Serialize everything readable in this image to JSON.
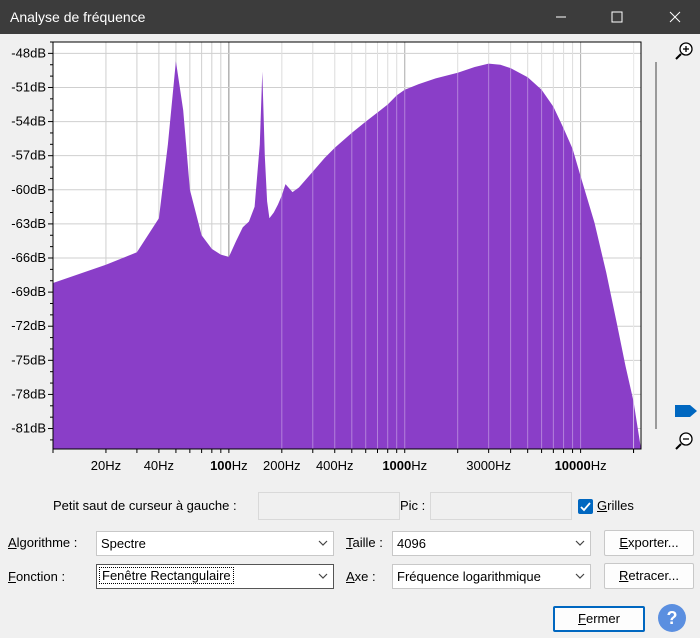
{
  "window": {
    "title": "Analyse de fréquence"
  },
  "chart_data": {
    "type": "area",
    "color": "#8a3ec8",
    "x_scale": "log",
    "xlim": [
      10,
      22050
    ],
    "ylim": [
      -82.8,
      -47
    ],
    "y_ticks": [
      "-48dB",
      "-51dB",
      "-54dB",
      "-57dB",
      "-60dB",
      "-63dB",
      "-66dB",
      "-69dB",
      "-72dB",
      "-75dB",
      "-78dB",
      "-81dB"
    ],
    "y_tick_values": [
      -48,
      -51,
      -54,
      -57,
      -60,
      -63,
      -66,
      -69,
      -72,
      -75,
      -78,
      -81
    ],
    "x_ticks": [
      {
        "label": "20Hz",
        "value": 20,
        "bold": false
      },
      {
        "label": "40Hz",
        "value": 40,
        "bold": false
      },
      {
        "label": "100",
        "value": 100,
        "bold": true,
        "suffix": "Hz"
      },
      {
        "label": "200Hz",
        "value": 200,
        "bold": false
      },
      {
        "label": "400Hz",
        "value": 400,
        "bold": false
      },
      {
        "label": "1000",
        "value": 1000,
        "bold": true,
        "suffix": "Hz"
      },
      {
        "label": "3000Hz",
        "value": 3000,
        "bold": false
      },
      {
        "label": "10000",
        "value": 10000,
        "bold": true,
        "suffix": "Hz"
      }
    ],
    "x": [
      10,
      20,
      30,
      40,
      45,
      50,
      55,
      60,
      70,
      80,
      90,
      100,
      110,
      120,
      130,
      140,
      150,
      155,
      160,
      165,
      170,
      180,
      190,
      200,
      210,
      230,
      250,
      300,
      350,
      400,
      500,
      600,
      700,
      800,
      900,
      1000,
      1200,
      1500,
      2000,
      2500,
      3000,
      3500,
      4000,
      5000,
      6000,
      7000,
      8000,
      9000,
      10000,
      12000,
      14000,
      16000,
      18000,
      20000,
      22050
    ],
    "y": [
      -68.2,
      -66.6,
      -65.5,
      -62.5,
      -56,
      -48.7,
      -53,
      -60,
      -64,
      -65.2,
      -65.7,
      -65.9,
      -64.5,
      -63.3,
      -62.8,
      -61.5,
      -56,
      -49.6,
      -57,
      -61,
      -62.5,
      -62,
      -61.3,
      -60.5,
      -59.5,
      -60.2,
      -59.8,
      -58.4,
      -57.2,
      -56.3,
      -55,
      -54,
      -53.2,
      -52.5,
      -51.7,
      -51.2,
      -50.7,
      -50.2,
      -49.7,
      -49.2,
      -48.9,
      -49,
      -49.3,
      -50.1,
      -51.2,
      -52.7,
      -54.6,
      -56.4,
      -58.8,
      -62.9,
      -67.3,
      -71.6,
      -75.5,
      -78.6,
      -82.8
    ]
  },
  "controls": {
    "cursor_label": "Petit saut de curseur à gauche :",
    "cursor_value": "",
    "pic_label": "Pic :",
    "pic_value": "",
    "grilles_label": "Grilles",
    "grilles_checked": true,
    "algo_label": "Algorithme :",
    "algo_value": "Spectre",
    "taille_label": "Taille :",
    "taille_value": "4096",
    "exporter_label": "Exporter...",
    "fonction_label": "Fonction :",
    "fonction_value": "Fenêtre Rectangulaire",
    "axe_label": "Axe :",
    "axe_value": "Fréquence logarithmique",
    "retracer_label": "Retracer...",
    "fermer_label": "Fermer",
    "help_label": "?"
  },
  "zoom": {
    "slider_value": 0,
    "zoom_in_icon": "zoom-in-icon",
    "zoom_out_icon": "zoom-out-icon"
  }
}
